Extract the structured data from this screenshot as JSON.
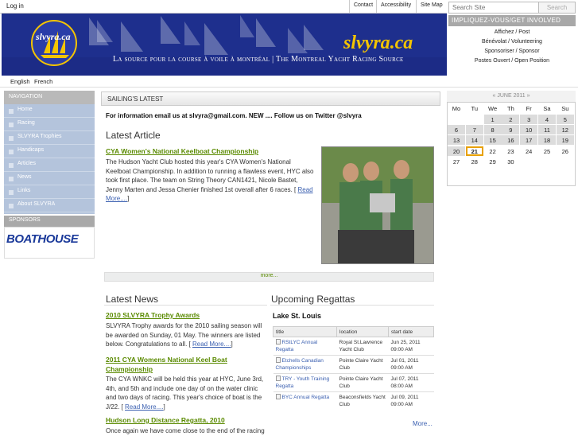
{
  "topbar": {
    "login": "Log in",
    "links": [
      "Contact",
      "Accessibility",
      "Site Map"
    ]
  },
  "search": {
    "placeholder": "Search Site",
    "button": "Search"
  },
  "banner": {
    "logo_text": "slvyra.ca",
    "brand": "slvyra.ca",
    "tagline": "La source pour la course à voile à montréal | The Montreal Yacht Racing Source"
  },
  "involved": {
    "title": "IMPLIQUEZ-VOUS/GET INVOLVED",
    "links": [
      "Affichez / Post",
      "Bénévolat / Volunteering",
      "Sponsoriser / Sponsor",
      "Postes Ouvert / Open Position"
    ]
  },
  "lang": [
    "English",
    "French"
  ],
  "nav": {
    "title": "NAVIGATION",
    "items": [
      "Home",
      "Racing",
      "SLVYRA Trophies",
      "Handicaps",
      "Articles",
      "News",
      "Links",
      "About SLVYRA"
    ]
  },
  "sponsors": {
    "title": "SPONSORS",
    "logo": "BOATHOUSE"
  },
  "main": {
    "section_title": "SAILING'S LATEST",
    "info": "For information email us at slvyra@gmail.com. NEW .... Follow us on Twitter @slvyra",
    "latest_article": {
      "heading": "Latest Article",
      "title": "CYA Women's National Keelboat Championship",
      "text": "The Hudson Yacht Club hosted this year's CYA Women's National Keelboat Championship. In addition to running a flawless event, HYC also took first place. The team on String Theory CAN1421, Nicole Bastet, Jenny Marten and Jessa Chenier finished 1st overall after 6 races.",
      "read_more": "Read More....",
      "more": "more..."
    },
    "news": {
      "heading": "Latest News",
      "items": [
        {
          "title": "2010 SLVYRA Trophy Awards",
          "text": "SLVYRA Trophy awards for the 2010 sailing season will be awarded on Sunday, 01 May. The winners are listed below. Congratulations to all.",
          "read_more": "Read More...."
        },
        {
          "title": "2011 CYA Womens National Keel Boat Championship",
          "text": "The CYA WNKC will be held this year at HYC, June 3rd, 4th, and 5th and include one day of on the water clinic and two days of racing. This year's choice of boat is the J/22.",
          "read_more": "Read More...."
        },
        {
          "title": "Hudson Long Distance Regatta, 2010",
          "text": "Once again we have come close to the end of the racing"
        }
      ]
    },
    "regattas": {
      "heading": "Upcoming Regattas",
      "location": "Lake St. Louis",
      "columns": [
        "title",
        "location",
        "start date"
      ],
      "rows": [
        {
          "title": "RStLYC Annual Regatta",
          "location": "Royal St.Lawrence Yacht Club",
          "date": "Jun 25, 2011 09:00 AM"
        },
        {
          "title": "Etchells Canadian Championships",
          "location": "Pointe Claire Yacht Club",
          "date": "Jul 01, 2011 09:00 AM"
        },
        {
          "title": "TRY - Youth Training Regatta",
          "location": "Pointe Claire Yacht Club",
          "date": "Jul 07, 2011 08:00 AM"
        },
        {
          "title": "BYC Annual Regatta",
          "location": "Beaconsfields Yacht Club",
          "date": "Jul 09, 2011 09:00 AM"
        }
      ],
      "more": "More..."
    }
  },
  "calendar": {
    "title": "« JUNE 2011 »",
    "days": [
      "Mo",
      "Tu",
      "We",
      "Th",
      "Fr",
      "Sa",
      "Su"
    ],
    "weeks": [
      [
        "",
        "",
        "1",
        "2",
        "3",
        "4",
        "5"
      ],
      [
        "6",
        "7",
        "8",
        "9",
        "10",
        "11",
        "12"
      ],
      [
        "13",
        "14",
        "15",
        "16",
        "17",
        "18",
        "19"
      ],
      [
        "20",
        "21",
        "22",
        "23",
        "24",
        "25",
        "26"
      ],
      [
        "27",
        "28",
        "29",
        "30",
        "",
        "",
        ""
      ]
    ],
    "today": "21",
    "colors": {
      "past": "#dcdcdc",
      "today_border": "#e8a000"
    }
  }
}
